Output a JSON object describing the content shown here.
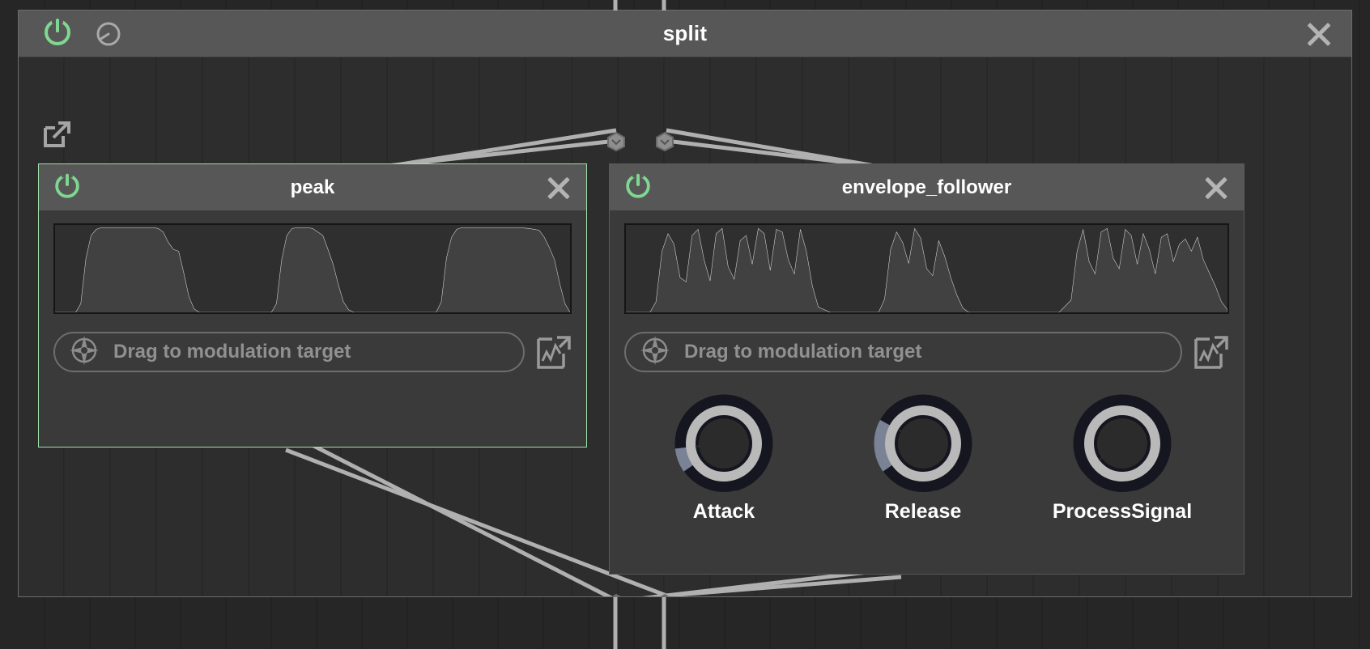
{
  "window": {
    "title": "split",
    "power_icon": "power-icon",
    "knob_icon": "knob-dial-icon",
    "close_icon": "close-icon",
    "popout_icon": "popout-expand-icon"
  },
  "colors": {
    "accent_green": "#7fd892",
    "selection_border": "#9fe0ab",
    "header_bg": "#575757",
    "module_bg": "#3a3a3a",
    "canvas_bg": "#2d2d2d",
    "scope_bg": "#2f2f2f",
    "wire": "#b0b0b0",
    "knob_arc": "#7a8296",
    "knob_ring": "#b9b9b9",
    "knob_outer": "#15161f",
    "text": "#ffffff",
    "muted_text": "#909090"
  },
  "modules": [
    {
      "id": "peak",
      "title": "peak",
      "selected": true,
      "power_icon": "power-icon",
      "close_icon": "close-icon",
      "modulation": {
        "label": "Drag to modulation target",
        "target_icon": "modulation-target-icon",
        "graph_icon": "modulation-graph-icon"
      },
      "knobs": []
    },
    {
      "id": "envelope_follower",
      "title": "envelope_follower",
      "selected": false,
      "power_icon": "power-icon",
      "close_icon": "close-icon",
      "modulation": {
        "label": "Drag to modulation target",
        "target_icon": "modulation-target-icon",
        "graph_icon": "modulation-graph-icon"
      },
      "knobs": [
        {
          "label": "Attack",
          "value_fraction": 0.1
        },
        {
          "label": "Release",
          "value_fraction": 0.22
        },
        {
          "label": "ProcessSignal",
          "value_fraction": 0.0
        }
      ]
    }
  ],
  "chart_data": [
    {
      "type": "line",
      "id": "peak-scope",
      "title": "peak",
      "xlabel": "",
      "ylabel": "",
      "xlim": [
        0,
        100
      ],
      "ylim": [
        0,
        1
      ],
      "grid": false,
      "legend": null,
      "x": [
        0,
        2,
        4,
        5,
        6,
        7,
        8,
        9,
        11,
        13,
        15,
        17,
        19,
        20,
        21,
        22,
        23,
        24,
        25,
        26,
        27,
        28,
        29,
        30,
        31,
        32,
        34,
        36,
        38,
        40,
        42,
        43,
        44,
        45,
        46,
        47,
        48,
        49,
        50,
        51,
        52,
        53,
        54,
        55,
        56,
        57,
        58,
        60,
        62,
        64,
        66,
        68,
        70,
        72,
        74,
        75,
        76,
        77,
        78,
        79,
        80,
        82,
        84,
        86,
        88,
        90,
        92,
        94,
        95,
        96,
        97,
        98,
        99,
        100
      ],
      "y": [
        0,
        0,
        0,
        0.1,
        0.62,
        0.88,
        0.95,
        0.97,
        0.97,
        0.97,
        0.97,
        0.97,
        0.97,
        0.96,
        0.92,
        0.8,
        0.72,
        0.7,
        0.45,
        0.18,
        0.04,
        0,
        0,
        0,
        0,
        0,
        0,
        0,
        0,
        0,
        0,
        0.1,
        0.6,
        0.88,
        0.96,
        0.97,
        0.97,
        0.97,
        0.96,
        0.92,
        0.88,
        0.72,
        0.55,
        0.32,
        0.12,
        0.03,
        0,
        0,
        0,
        0,
        0,
        0,
        0,
        0,
        0,
        0.12,
        0.62,
        0.86,
        0.95,
        0.97,
        0.97,
        0.97,
        0.97,
        0.97,
        0.97,
        0.97,
        0.96,
        0.94,
        0.86,
        0.74,
        0.6,
        0.33,
        0.1,
        0
      ]
    },
    {
      "type": "line",
      "id": "envelope-follower-scope",
      "title": "envelope_follower",
      "xlabel": "",
      "ylabel": "",
      "xlim": [
        0,
        100
      ],
      "ylim": [
        0,
        1
      ],
      "grid": false,
      "legend": null,
      "x": [
        0,
        2,
        4,
        5,
        6,
        7,
        8,
        9,
        10,
        11,
        12,
        13,
        14,
        15,
        16,
        17,
        18,
        19,
        20,
        21,
        22,
        23,
        24,
        25,
        26,
        27,
        28,
        29,
        30,
        31,
        32,
        34,
        36,
        38,
        40,
        42,
        43,
        44,
        45,
        46,
        47,
        48,
        49,
        50,
        51,
        52,
        53,
        54,
        55,
        56,
        57,
        58,
        60,
        62,
        64,
        66,
        68,
        70,
        72,
        74,
        75,
        76,
        77,
        78,
        79,
        80,
        81,
        82,
        83,
        84,
        85,
        86,
        87,
        88,
        89,
        90,
        91,
        92,
        93,
        94,
        95,
        96,
        97,
        98,
        99,
        100
      ],
      "y": [
        0,
        0,
        0,
        0.12,
        0.7,
        0.9,
        0.78,
        0.4,
        0.35,
        0.88,
        0.95,
        0.6,
        0.36,
        0.9,
        0.96,
        0.52,
        0.38,
        0.82,
        0.88,
        0.55,
        0.96,
        0.9,
        0.48,
        0.95,
        0.92,
        0.6,
        0.44,
        0.95,
        0.7,
        0.3,
        0.06,
        0,
        0,
        0,
        0,
        0,
        0.15,
        0.72,
        0.92,
        0.8,
        0.56,
        0.96,
        0.85,
        0.5,
        0.42,
        0.82,
        0.64,
        0.4,
        0.2,
        0.05,
        0,
        0,
        0,
        0,
        0,
        0,
        0,
        0,
        0,
        0.14,
        0.7,
        0.95,
        0.58,
        0.44,
        0.92,
        0.96,
        0.62,
        0.5,
        0.95,
        0.88,
        0.55,
        0.9,
        0.72,
        0.44,
        0.86,
        0.9,
        0.58,
        0.78,
        0.84,
        0.7,
        0.86,
        0.6,
        0.45,
        0.3,
        0.12,
        0.03,
        0
      ]
    }
  ]
}
